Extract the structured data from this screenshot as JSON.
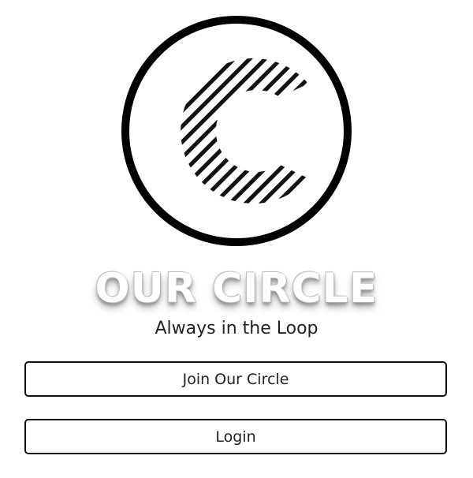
{
  "brand": {
    "logo": "circle-c-logo",
    "title": "OUR CIRCLE",
    "tagline": "Always in the Loop"
  },
  "actions": {
    "join_label": "Join Our Circle",
    "login_label": "Login"
  },
  "colors": {
    "ring": "#000000",
    "stripe_main": "#111111",
    "stripe_red": "#d9122b",
    "stripe_cyan": "#27d6e0",
    "text": "#222222",
    "button_border": "#111111"
  }
}
